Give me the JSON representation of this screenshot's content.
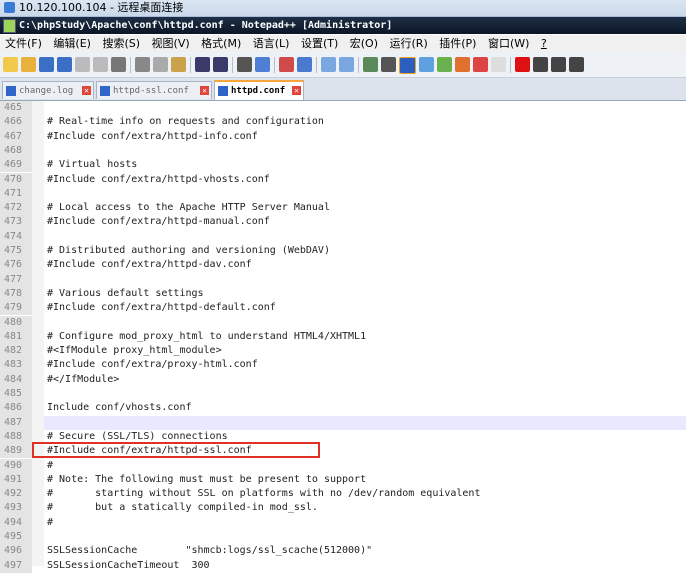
{
  "rdp": {
    "title": "10.120.100.104 - 远程桌面连接"
  },
  "window": {
    "title": "C:\\phpStudy\\Apache\\conf\\httpd.conf - Notepad++ [Administrator]"
  },
  "menu": [
    "文件(F)",
    "编辑(E)",
    "搜索(S)",
    "视图(V)",
    "格式(M)",
    "语言(L)",
    "设置(T)",
    "宏(O)",
    "运行(R)",
    "插件(P)",
    "窗口(W)",
    "?"
  ],
  "tabs": [
    {
      "label": "change.log"
    },
    {
      "label": "httpd-ssl.conf"
    },
    {
      "label": "httpd.conf"
    }
  ],
  "lines": [
    {
      "n": "465",
      "t": ""
    },
    {
      "n": "466",
      "t": "# Real-time info on requests and configuration"
    },
    {
      "n": "467",
      "t": "#Include conf/extra/httpd-info.conf"
    },
    {
      "n": "468",
      "t": ""
    },
    {
      "n": "469",
      "t": "# Virtual hosts"
    },
    {
      "n": "470",
      "t": "#Include conf/extra/httpd-vhosts.conf"
    },
    {
      "n": "471",
      "t": ""
    },
    {
      "n": "472",
      "t": "# Local access to the Apache HTTP Server Manual"
    },
    {
      "n": "473",
      "t": "#Include conf/extra/httpd-manual.conf"
    },
    {
      "n": "474",
      "t": ""
    },
    {
      "n": "475",
      "t": "# Distributed authoring and versioning (WebDAV)"
    },
    {
      "n": "476",
      "t": "#Include conf/extra/httpd-dav.conf"
    },
    {
      "n": "477",
      "t": ""
    },
    {
      "n": "478",
      "t": "# Various default settings"
    },
    {
      "n": "479",
      "t": "#Include conf/extra/httpd-default.conf"
    },
    {
      "n": "480",
      "t": ""
    },
    {
      "n": "481",
      "t": "# Configure mod_proxy_html to understand HTML4/XHTML1"
    },
    {
      "n": "482",
      "t": "#<IfModule proxy_html_module>"
    },
    {
      "n": "483",
      "t": "#Include conf/extra/proxy-html.conf"
    },
    {
      "n": "484",
      "t": "#</IfModule>"
    },
    {
      "n": "485",
      "t": ""
    },
    {
      "n": "486",
      "t": "Include conf/vhosts.conf"
    },
    {
      "n": "487",
      "t": ""
    },
    {
      "n": "488",
      "t": "# Secure (SSL/TLS) connections"
    },
    {
      "n": "489",
      "t": "#Include conf/extra/httpd-ssl.conf"
    },
    {
      "n": "490",
      "t": "#"
    },
    {
      "n": "491",
      "t": "# Note: The following must must be present to support"
    },
    {
      "n": "492",
      "t": "#       starting without SSL on platforms with no /dev/random equivalent"
    },
    {
      "n": "493",
      "t": "#       but a statically compiled-in mod_ssl."
    },
    {
      "n": "494",
      "t": "#"
    },
    {
      "n": "495",
      "t": ""
    },
    {
      "n": "496",
      "t": "SSLSessionCache        \"shmcb:logs/ssl_scache(512000)\""
    },
    {
      "n": "497",
      "t": "SSLSessionCacheTimeout  300"
    }
  ],
  "current_line": "487",
  "highlighted_line": "489",
  "colors": {
    "highlight_box": "#e0302a",
    "title_bar": "#0b1626",
    "active_tab_accent": "#f7a53a"
  }
}
